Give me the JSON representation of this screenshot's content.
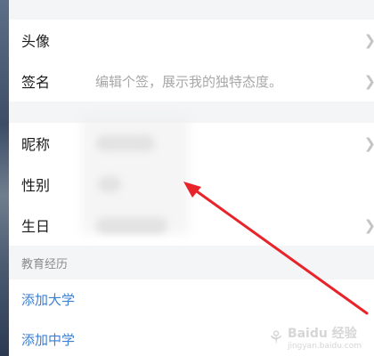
{
  "profile": {
    "avatar_label": "头像",
    "signature_label": "签名",
    "signature_placeholder": "编辑个签，展示我的独特态度。",
    "nickname_label": "昵称",
    "gender_label": "性别",
    "birthday_label": "生日"
  },
  "education": {
    "section_title": "教育经历",
    "add_university": "添加大学",
    "add_high_school": "添加中学"
  },
  "icons": {
    "chevron": "chevron-right-icon"
  },
  "watermark": {
    "brand": "Baidu 经验",
    "sub": "jingyan.baidu.com"
  },
  "colors": {
    "link": "#3f7fd1",
    "arrow": "#e8242a"
  }
}
